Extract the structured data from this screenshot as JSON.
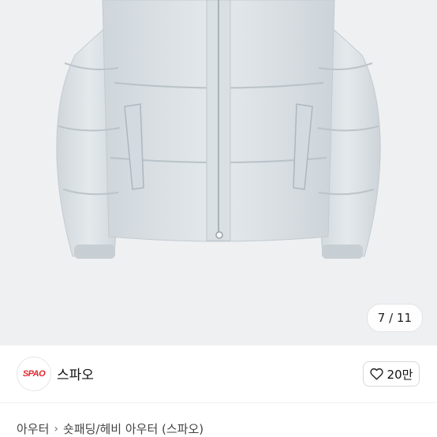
{
  "gallery": {
    "counter": "7 / 11"
  },
  "seller": {
    "logo_text": "SPAO",
    "name": "스파오"
  },
  "like": {
    "icon": "heart-outline-icon",
    "count": "20만"
  },
  "breadcrumb": {
    "items": [
      "아우터",
      "숏패딩/헤비 아우터 (스파오)"
    ],
    "separator_icon": "chevron-right-icon"
  },
  "colors": {
    "jacket": "#dde3e7",
    "photo_bg": "#eef0f2",
    "brand_red": "#e3262e"
  }
}
